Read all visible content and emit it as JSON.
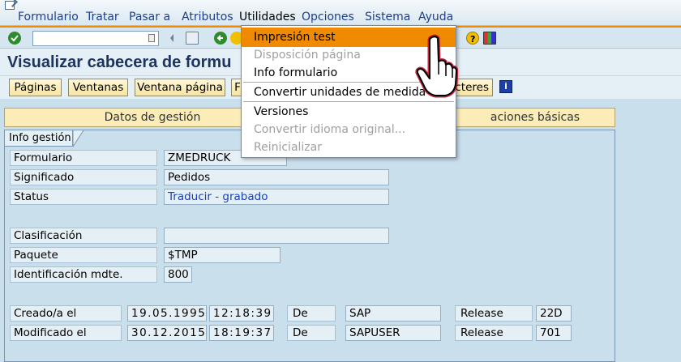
{
  "menubar": {
    "items": [
      "Formulario",
      "Tratar",
      "Pasar a",
      "Atributos",
      "Utilidades",
      "Opciones",
      "Sistema",
      "Ayuda"
    ]
  },
  "command_field": {
    "value": ""
  },
  "page_title": "Visualizar cabecera de formu",
  "app_toolbar": {
    "buttons": [
      "Páginas",
      "Ventanas",
      "Ventana página",
      "F",
      "cteres"
    ]
  },
  "tabs": [
    "Datos de gestión",
    "aciones básicas"
  ],
  "group_label": "Info gestión",
  "fields": {
    "formulario": {
      "label": "Formulario",
      "value": "ZMEDRUCK"
    },
    "significado": {
      "label": "Significado",
      "value": "Pedidos"
    },
    "status": {
      "label": "Status",
      "value": "Traducir - grabado"
    },
    "clasificacion": {
      "label": "Clasificación",
      "value": ""
    },
    "paquete": {
      "label": "Paquete",
      "value": "$TMP"
    },
    "idioma": {
      "label": "Identificación mdte.",
      "value": "800"
    },
    "creado": {
      "label": "Creado/a el",
      "date": "19.05.1995",
      "time": "12:18:39",
      "de_label": "De",
      "user": "SAP",
      "release_label": "Release",
      "release": "22D"
    },
    "modificado": {
      "label": "Modificado el",
      "date": "30.12.2015",
      "time": "18:19:37",
      "de_label": "De",
      "user": "SAPUSER",
      "release_label": "Release",
      "release": "701"
    }
  },
  "dropdown": {
    "items": [
      {
        "label": "Impresión test",
        "state": "highlighted"
      },
      {
        "label": "Disposición página",
        "state": "disabled"
      },
      {
        "label": "Info formulario",
        "state": "enabled"
      },
      {
        "label": "Convertir unidades de medida",
        "state": "enabled"
      },
      {
        "label": "Versiones",
        "state": "enabled"
      },
      {
        "label": "Convertir idioma original...",
        "state": "disabled"
      },
      {
        "label": "Reinicializar",
        "state": "disabled"
      }
    ]
  },
  "colors": {
    "highlight": "#f08a00",
    "accent_line": "#f28b00",
    "field_bg": "#e5eff6",
    "panel_bg": "#c9dfec",
    "button_bg": "#f7e4a2"
  },
  "icons": [
    "enter-icon",
    "save-icon",
    "back-icon",
    "exit-icon",
    "help-icon",
    "layout-icon",
    "info-icon"
  ]
}
